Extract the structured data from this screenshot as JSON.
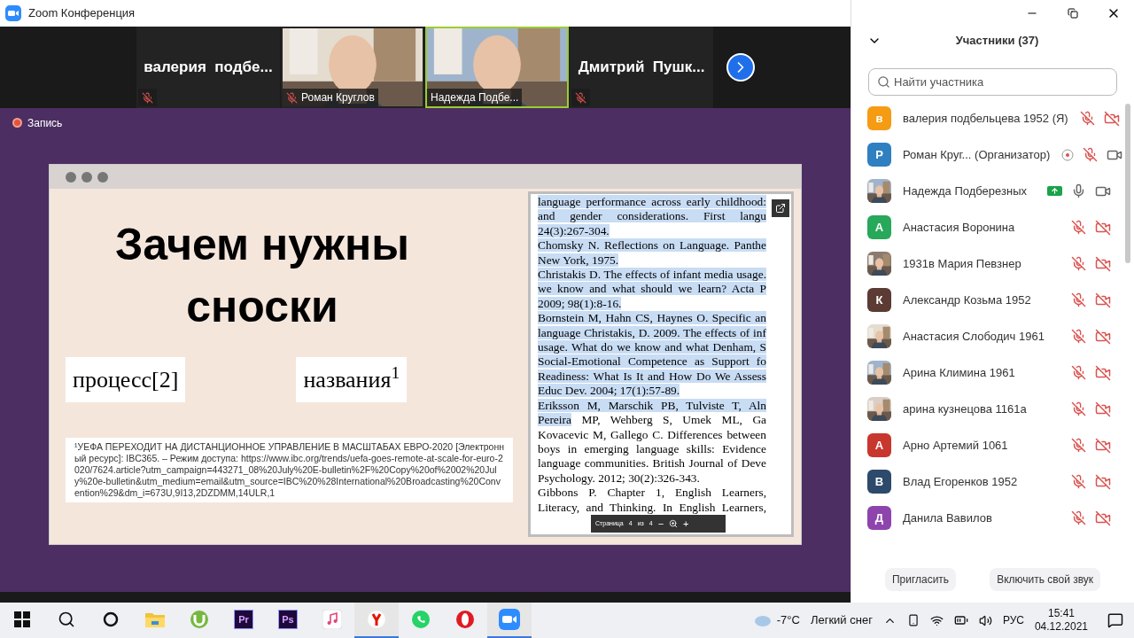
{
  "window": {
    "title": "Zoom Конференция"
  },
  "video_strip": {
    "tiles": [
      {
        "kind": "name",
        "name": "валерия  подбе...",
        "muted": true,
        "speaking": false
      },
      {
        "kind": "video",
        "name": "Роман Круглов",
        "muted": true,
        "speaking": false
      },
      {
        "kind": "video",
        "name": "Надежда Подбе...",
        "muted": false,
        "speaking": true
      },
      {
        "kind": "name",
        "name": "Дмитрий  Пушк...",
        "muted": true,
        "speaking": false
      }
    ]
  },
  "recording": {
    "label": "Запись"
  },
  "slide": {
    "title": "Зачем нужны сноски",
    "examples": [
      "процесс[2]",
      "названия$^{1}$"
    ],
    "footnote": "¹УЕФА ПЕРЕХОДИТ НА ДИСТАНЦИОННОЕ УПРАВЛЕНИЕ В МАСШТАБАХ ЕВРО-2020 [Электронный ресурс]: IBC365. – Режим доступа: https://www.ibc.org/trends/uefa-goes-remote-at-scale-for-euro-2020/7624.article?utm_campaign=443271_08%20July%20E-bulletin%2F%20Copy%20of%2002%20July%20e-bulletin&utm_medium=email&utm_source=IBC%20%28International%20Broadcasting%20Convention%29&dm_i=673U,9I13,2DZDMM,14ULR,1",
    "document": {
      "lines": [
        {
          "justified": true,
          "segments": [
            {
              "text": "language performance across early childhood:",
              "highlighted": true
            }
          ]
        },
        {
          "justified": true,
          "segments": [
            {
              "text": "and gender considerations. First langu",
              "highlighted": true
            }
          ]
        },
        {
          "justified": false,
          "segments": [
            {
              "text": "24(3):267-304.",
              "highlighted": true
            }
          ]
        },
        {
          "justified": true,
          "segments": [
            {
              "text": "Chomsky N. Reflections on Language. Panthe",
              "highlighted": true
            }
          ]
        },
        {
          "justified": false,
          "segments": [
            {
              "text": "New York, 1975.",
              "highlighted": true
            }
          ]
        },
        {
          "justified": true,
          "segments": [
            {
              "text": "Christakis D. The effects of infant media usage.",
              "highlighted": true
            }
          ]
        },
        {
          "justified": true,
          "segments": [
            {
              "text": "we know and what should we learn? Acta P",
              "highlighted": true
            }
          ]
        },
        {
          "justified": false,
          "segments": [
            {
              "text": "2009; 98(1):8-16.",
              "highlighted": true
            }
          ]
        },
        {
          "justified": true,
          "segments": [
            {
              "text": "Bornstein M, Hahn CS, Haynes O. Specific an",
              "highlighted": true
            }
          ]
        },
        {
          "justified": true,
          "segments": [
            {
              "text": "language Christakis, D. 2009. The effects of inf",
              "highlighted": true
            }
          ]
        },
        {
          "justified": true,
          "segments": [
            {
              "text": "usage. What do we know and what Denham, S",
              "highlighted": true
            }
          ]
        },
        {
          "justified": true,
          "segments": [
            {
              "text": "Social-Emotional Competence as Support fo",
              "highlighted": true
            }
          ]
        },
        {
          "justified": true,
          "segments": [
            {
              "text": "Readiness: What Is It and How Do We Assess",
              "highlighted": true
            }
          ]
        },
        {
          "justified": false,
          "segments": [
            {
              "text": "Educ Dev. 2004; 17(1):57-89.",
              "highlighted": true
            }
          ]
        },
        {
          "justified": true,
          "segments": [
            {
              "text": "Eriksson M, Marschik PB, Tulviste T, Aln",
              "highlighted": true
            }
          ]
        },
        {
          "justified": true,
          "segments": [
            {
              "text": "Pereira",
              "highlighted": true
            },
            {
              "text": " MP, Wehberg S, Umek ML, Ga",
              "highlighted": false
            }
          ]
        },
        {
          "justified": true,
          "segments": [
            {
              "text": "Kovacevic M, Gallego C. Differences between",
              "highlighted": false
            }
          ]
        },
        {
          "justified": true,
          "segments": [
            {
              "text": "boys in emerging language skills: Evidence",
              "highlighted": false
            }
          ]
        },
        {
          "justified": true,
          "segments": [
            {
              "text": "language communities. British Journal of Deve",
              "highlighted": false
            }
          ]
        },
        {
          "justified": false,
          "segments": [
            {
              "text": "Psychology. 2012; 30(2):326-343.",
              "highlighted": false
            }
          ]
        },
        {
          "justified": true,
          "segments": [
            {
              "text": "Gibbons P. Chapter 1, English Learners,",
              "highlighted": false
            }
          ]
        },
        {
          "justified": true,
          "segments": [
            {
              "text": "Literacy, and Thinking. In English Learners,",
              "highlighted": false
            }
          ]
        }
      ],
      "toolbar": {
        "page_label": "Страница",
        "page": "4",
        "of": "из",
        "total": "4",
        "zoom_out": "−",
        "zoom_in": "+"
      }
    }
  },
  "participants": {
    "title": "Участники (37)",
    "search": {
      "placeholder": "Найти участника"
    },
    "items": [
      {
        "name": "валерия подбельцева 1952 (Я)",
        "avatar": {
          "kind": "letter",
          "letter": "в",
          "color": "#f59b14"
        },
        "mic_muted": true,
        "video_off": true,
        "recording": false,
        "sharing": false
      },
      {
        "name": "Роман Круг... (Организатор)",
        "avatar": {
          "kind": "letter",
          "letter": "Р",
          "color": "#2f7fc1"
        },
        "mic_muted": true,
        "video_off": false,
        "recording": true,
        "sharing": false
      },
      {
        "name": "Надежда Подберезных",
        "mic_muted": false,
        "video_off": false,
        "recording": false,
        "sharing": true
      },
      {
        "name": "Анастасия Воронина",
        "avatar": {
          "kind": "letter",
          "letter": "А",
          "color": "#27a85a"
        },
        "mic_muted": true,
        "video_off": true,
        "recording": false,
        "sharing": false
      },
      {
        "name": "1931в Мария Певзнер",
        "mic_muted": true,
        "video_off": true,
        "recording": false,
        "sharing": false
      },
      {
        "name": "Александр Козьма 1952",
        "avatar": {
          "kind": "letter",
          "letter": "К",
          "color": "#5b3b33"
        },
        "mic_muted": true,
        "video_off": true,
        "recording": false,
        "sharing": false
      },
      {
        "name": "Анастасия Слободич 1961",
        "mic_muted": true,
        "video_off": true,
        "recording": false,
        "sharing": false
      },
      {
        "name": "Арина Климина 1961",
        "mic_muted": true,
        "video_off": true,
        "recording": false,
        "sharing": false
      },
      {
        "name": "арина кузнецова 1161а",
        "mic_muted": true,
        "video_off": true,
        "recording": false,
        "sharing": false
      },
      {
        "name": "Арно Артемий 1061",
        "avatar": {
          "kind": "letter",
          "letter": "А",
          "color": "#c8372d"
        },
        "mic_muted": true,
        "video_off": true,
        "recording": false,
        "sharing": false
      },
      {
        "name": "Влад Егоренков 1952",
        "avatar": {
          "kind": "letter",
          "letter": "В",
          "color": "#2d4a6b"
        },
        "mic_muted": true,
        "video_off": true,
        "recording": false,
        "sharing": false
      },
      {
        "name": "Данила Вавилов",
        "avatar": {
          "kind": "letter",
          "letter": "Д",
          "color": "#8e44ad"
        },
        "mic_muted": true,
        "video_off": true,
        "recording": false,
        "sharing": false
      }
    ],
    "buttons": [
      "Пригласить",
      "Включить свой звук"
    ]
  },
  "taskbar": {
    "apps": [
      {
        "kind": "start",
        "running": false
      },
      {
        "kind": "search",
        "running": false
      },
      {
        "kind": "cortana",
        "running": false
      },
      {
        "kind": "explorer",
        "running": false
      },
      {
        "kind": "torrent",
        "running": false
      },
      {
        "kind": "letter",
        "label": "Pr",
        "running": false
      },
      {
        "kind": "letter",
        "label": "Ps",
        "running": false
      },
      {
        "kind": "music",
        "running": false
      },
      {
        "kind": "yandex",
        "running": true
      },
      {
        "kind": "whatsapp",
        "running": false
      },
      {
        "kind": "opera",
        "running": false
      },
      {
        "kind": "zoom",
        "running": true
      }
    ],
    "weather": {
      "temperature": "-7°C",
      "condition": "Легкий снег"
    },
    "language": "РУС",
    "time": "15:41",
    "date": "04.12.2021"
  }
}
